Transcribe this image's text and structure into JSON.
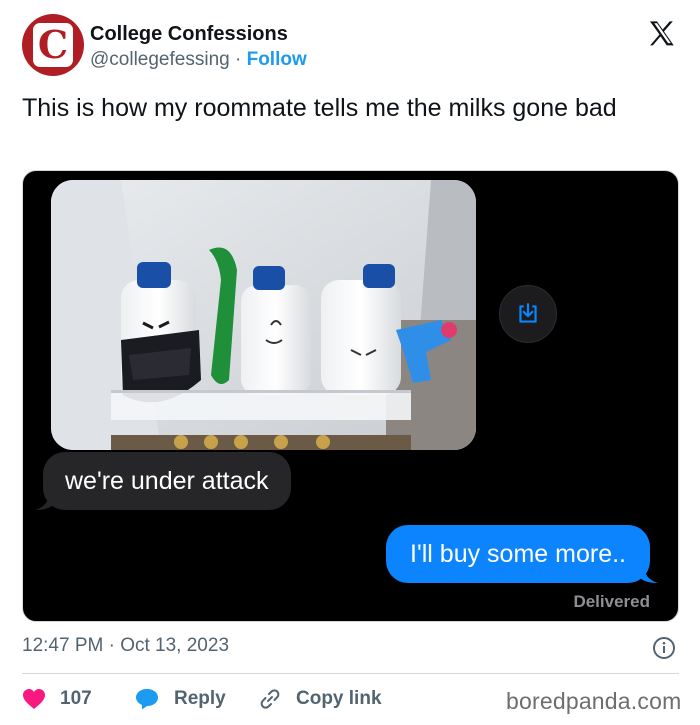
{
  "account": {
    "avatar_letter": "C",
    "name": "College Confessions",
    "handle": "@collegefessing",
    "separator": "·",
    "follow_label": "Follow"
  },
  "tweet": {
    "text": "This is how my roommate tells me the milks gone bad",
    "timestamp": "12:47 PM · Oct 13, 2023"
  },
  "media": {
    "received_message": "we're under attack",
    "sent_message": "I'll buy some more..",
    "status": "Delivered"
  },
  "actions": {
    "like_count": "107",
    "reply_label": "Reply",
    "copy_label": "Copy link"
  },
  "watermark": "boredpanda.com",
  "colors": {
    "brand_red": "#b01e25",
    "link_blue": "#1d9bf0",
    "imessage_blue": "#0b84fe",
    "like_pink": "#f91880"
  }
}
